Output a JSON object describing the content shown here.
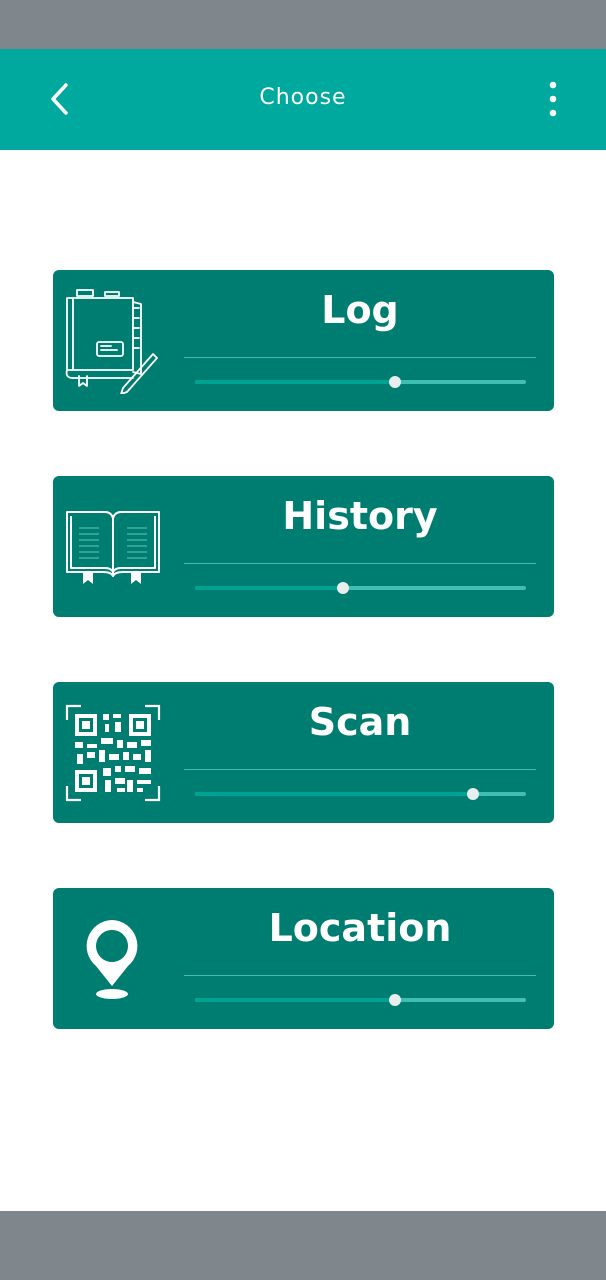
{
  "colors": {
    "status_bar": "#7f878d",
    "app_bar": "#00a99d",
    "card": "#007d71",
    "slider_track": "#3fbfb2",
    "slider_fill": "#00a293",
    "thumb": "#e8eded"
  },
  "app_bar": {
    "title": "Choose",
    "back_icon": "chevron-left-icon",
    "menu_icon": "more-vertical-icon"
  },
  "cards": [
    {
      "label": "Log",
      "icon": "notebook-pencil-icon",
      "slider_value": 0.605
    },
    {
      "label": "History",
      "icon": "open-book-icon",
      "slider_value": 0.447
    },
    {
      "label": "Scan",
      "icon": "qr-code-icon",
      "slider_value": 0.84
    },
    {
      "label": "Location",
      "icon": "location-pin-icon",
      "slider_value": 0.605
    }
  ]
}
